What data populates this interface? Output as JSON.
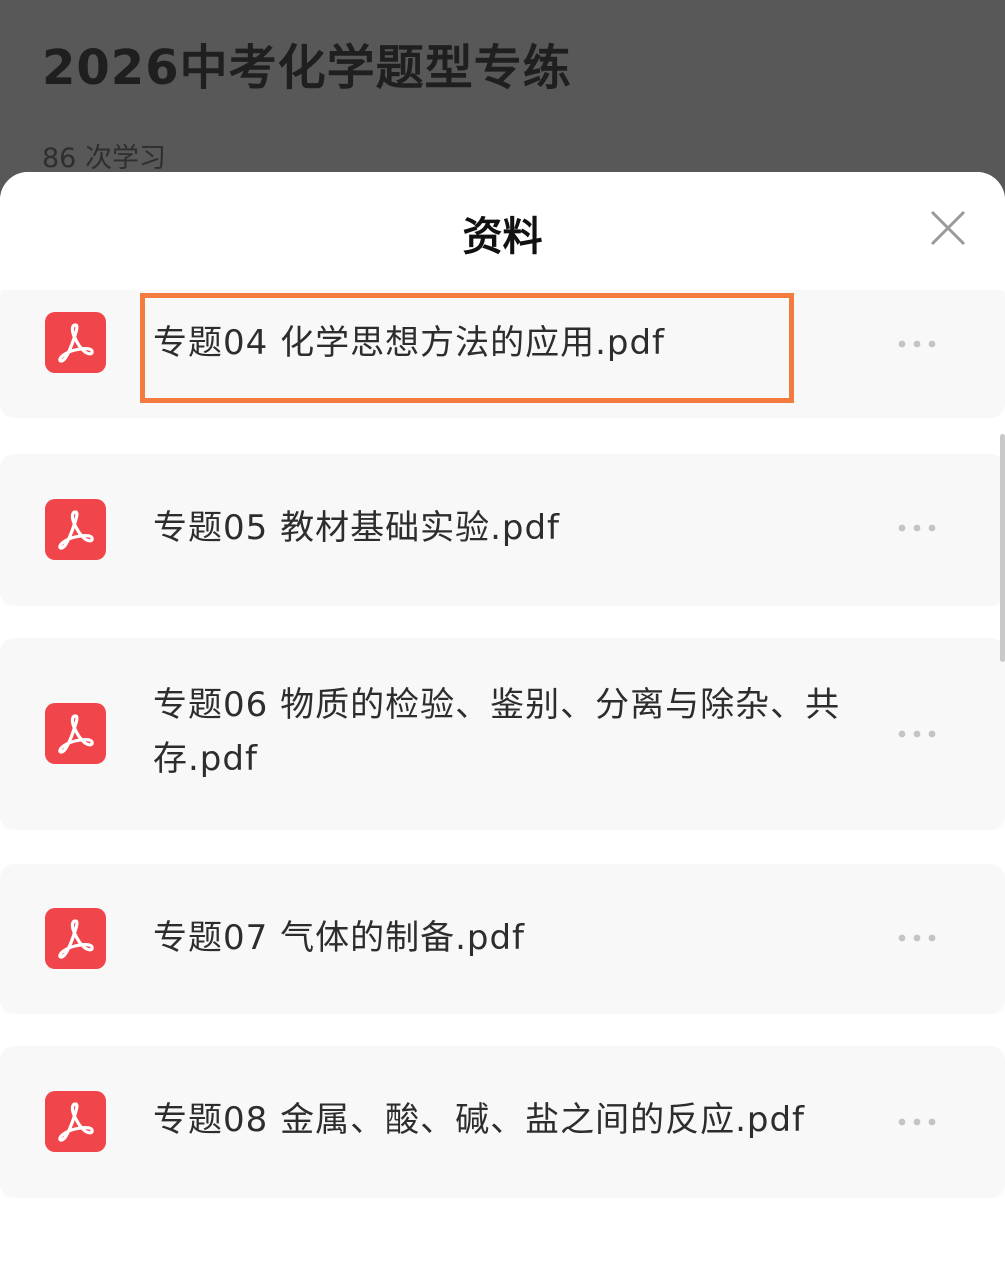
{
  "background": {
    "title": "2026中考化学题型专练",
    "learn_count": "86 次学习"
  },
  "sheet": {
    "title": "资料",
    "close_icon": "close-icon"
  },
  "files": [
    {
      "name": "专题04 化学思想方法的应用.pdf",
      "icon": "pdf-icon",
      "highlighted": true
    },
    {
      "name": "专题05 教材基础实验.pdf",
      "icon": "pdf-icon",
      "highlighted": false
    },
    {
      "name": "专题06 物质的检验、鉴别、分离与除杂、共存.pdf",
      "icon": "pdf-icon",
      "highlighted": false
    },
    {
      "name": "专题07 气体的制备.pdf",
      "icon": "pdf-icon",
      "highlighted": false
    },
    {
      "name": "专题08 金属、酸、碱、盐之间的反应.pdf",
      "icon": "pdf-icon",
      "highlighted": false
    }
  ],
  "colors": {
    "pdf_red": "#f0454a",
    "highlight_orange": "#f47b3f",
    "item_bg": "#f8f8f8",
    "overlay_bg": "#585858"
  }
}
